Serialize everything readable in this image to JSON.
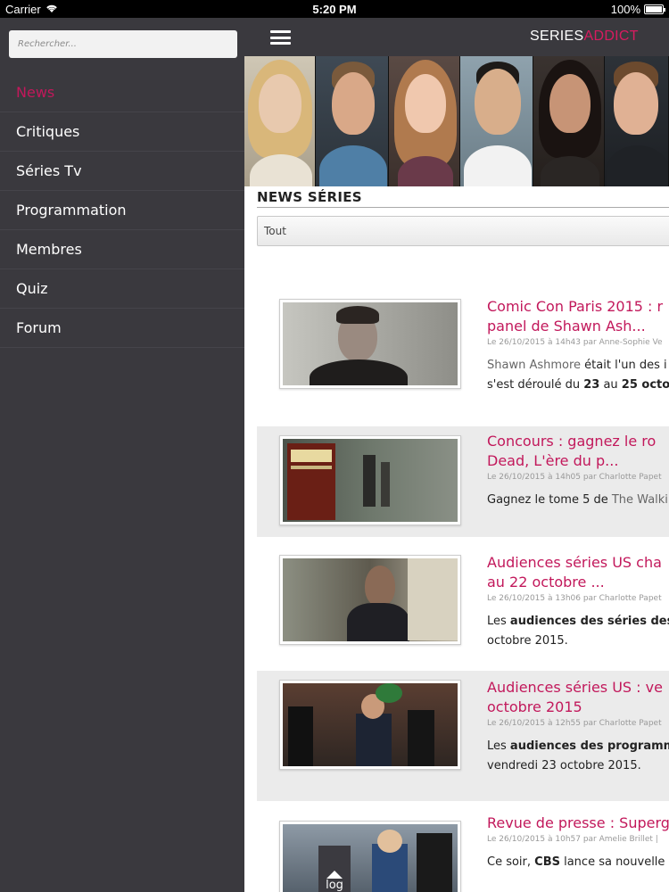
{
  "statusbar": {
    "carrier": "Carrier",
    "time": "5:20 PM",
    "battery": "100%",
    "battery_level": 1.0
  },
  "sidebar": {
    "search_placeholder": "Rechercher...",
    "items": [
      {
        "label": "News",
        "active": true
      },
      {
        "label": "Critiques",
        "active": false
      },
      {
        "label": "Séries Tv",
        "active": false
      },
      {
        "label": "Programmation",
        "active": false
      },
      {
        "label": "Membres",
        "active": false
      },
      {
        "label": "Quiz",
        "active": false
      },
      {
        "label": "Forum",
        "active": false
      }
    ]
  },
  "header": {
    "logo_part1": "SERIES",
    "logo_part2": "ADDICT"
  },
  "main": {
    "section_title": "NEWS SÉRIES",
    "filter_value": "Tout",
    "articles": [
      {
        "title1": "Comic Con Paris 2015 : r",
        "title2": "panel de Shawn Ash...",
        "meta": "Le 26/10/2015 à 14h43 par Anne-Sophie Ve",
        "ex1_muted": "Shawn Ashmore",
        "ex1_rest": " était l'un des i",
        "ex2_pre": "s'est déroulé du ",
        "ex2_b1": "23",
        "ex2_mid": " au ",
        "ex2_b2": "25 octo"
      },
      {
        "title1": "Concours : gagnez le ro",
        "title2": "Dead, L'ère du p...",
        "meta": "Le 26/10/2015 à 14h05 par Charlotte Papet",
        "ex1_pre": "Gagnez le tome 5 de ",
        "ex1_muted": "The Walki"
      },
      {
        "title1": "Audiences séries US cha",
        "title2": "au 22 octobre ...",
        "meta": "Le 26/10/2015 à 13h06 par Charlotte Papet",
        "ex1_pre": "Les ",
        "ex1_b": "audiences des séries des c",
        "ex2": "octobre 2015."
      },
      {
        "title1": "Audiences séries US : ve",
        "title2": "octobre 2015",
        "meta": "Le 26/10/2015 à 12h55 par Charlotte Papet",
        "ex1_pre": "Les ",
        "ex1_b": "audiences des programme",
        "ex2": "vendredi 23 octobre 2015."
      },
      {
        "title1": "Revue de presse : Superg",
        "meta": "Le 26/10/2015 à 10h57 par Amelie Brillet |",
        "ex1_pre": "Ce soir, ",
        "ex1_b": "CBS",
        "ex1_rest": " lance sa nouvelle s"
      }
    ]
  },
  "log_button": {
    "label": "log"
  }
}
